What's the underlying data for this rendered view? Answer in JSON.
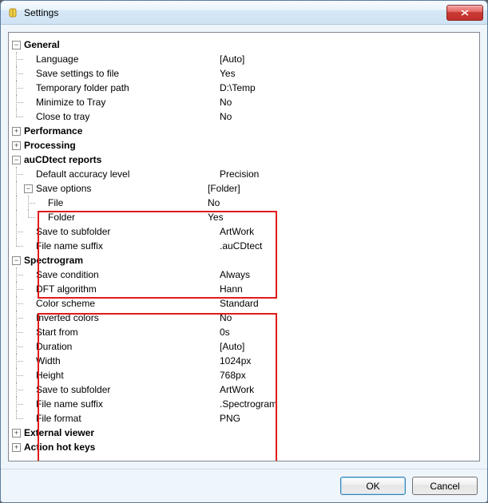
{
  "window": {
    "title": "Settings"
  },
  "buttons": {
    "ok": "OK",
    "cancel": "Cancel"
  },
  "tree": {
    "general": {
      "label": "General",
      "language": {
        "label": "Language",
        "value": "[Auto]"
      },
      "save_settings": {
        "label": "Save settings to file",
        "value": "Yes"
      },
      "temp_folder": {
        "label": "Temporary folder path",
        "value": "D:\\Temp"
      },
      "minimize_tray": {
        "label": "Minimize to Tray",
        "value": "No"
      },
      "close_tray": {
        "label": "Close to tray",
        "value": "No"
      }
    },
    "performance": {
      "label": "Performance"
    },
    "processing": {
      "label": "Processing"
    },
    "aucdtect": {
      "label": "auCDtect reports",
      "accuracy": {
        "label": "Default accuracy level",
        "value": "Precision"
      },
      "save_options": {
        "label": "Save options",
        "value": "[Folder]",
        "file": {
          "label": "File",
          "value": "No"
        },
        "folder": {
          "label": "Folder",
          "value": "Yes"
        }
      },
      "subfolder": {
        "label": "Save to subfolder",
        "value": "ArtWork"
      },
      "suffix": {
        "label": "File name suffix",
        "value": ".auCDtect"
      }
    },
    "spectrogram": {
      "label": "Spectrogram",
      "save_condition": {
        "label": "Save condition",
        "value": "Always"
      },
      "dft": {
        "label": "DFT algorithm",
        "value": "Hann"
      },
      "color_scheme": {
        "label": "Color scheme",
        "value": "Standard"
      },
      "inverted": {
        "label": "Inverted colors",
        "value": "No"
      },
      "start_from": {
        "label": "Start from",
        "value": "0s"
      },
      "duration": {
        "label": "Duration",
        "value": "[Auto]"
      },
      "width": {
        "label": "Width",
        "value": "1024px"
      },
      "height": {
        "label": "Height",
        "value": "768px"
      },
      "subfolder": {
        "label": "Save to subfolder",
        "value": "ArtWork"
      },
      "suffix": {
        "label": "File name suffix",
        "value": ".Spectrogram"
      },
      "format": {
        "label": "File format",
        "value": "PNG"
      }
    },
    "external_viewer": {
      "label": "External viewer"
    },
    "hotkeys": {
      "label": "Action hot keys"
    }
  }
}
